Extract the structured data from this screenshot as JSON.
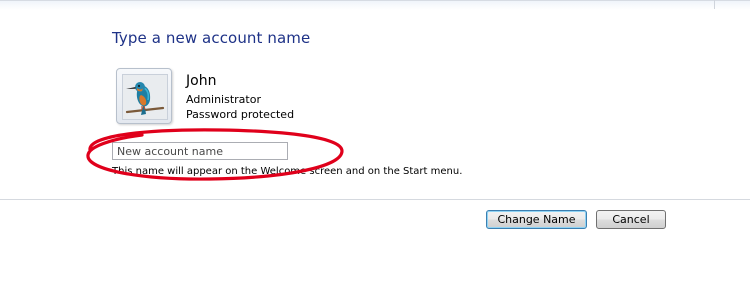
{
  "dialog": {
    "title": "Type a new account name"
  },
  "user": {
    "name": "John",
    "role": "Administrator",
    "status": "Password protected",
    "avatar_icon": "kingfisher-bird-icon"
  },
  "form": {
    "placeholder": "New account name",
    "value": "",
    "hint": "This name will appear on the Welcome screen and on the Start menu."
  },
  "buttons": {
    "change_name": "Change Name",
    "cancel": "Cancel"
  },
  "colors": {
    "title": "#1e3287",
    "annotation_red": "#e0001b",
    "primary_button_border": "#3c7fb1"
  }
}
